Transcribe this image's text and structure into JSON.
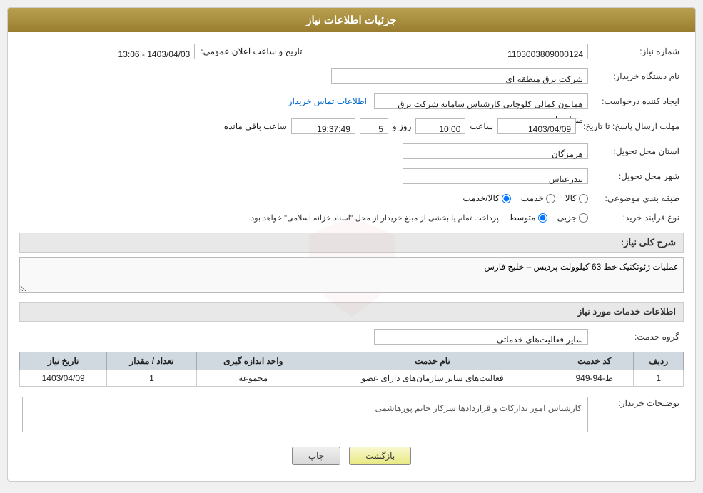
{
  "page": {
    "title": "جزئیات اطلاعات نیاز"
  },
  "header": {
    "title": "جزئیات اطلاعات نیاز"
  },
  "fields": {
    "need_number_label": "شماره نیاز:",
    "need_number_value": "1103003809000124",
    "buyer_org_label": "نام دستگاه خریدار:",
    "buyer_org_value": "شرکت برق منطقه ای",
    "creator_label": "ایجاد کننده درخواست:",
    "creator_value": "همایون کمالی کلوچانی کارشناس سامانه شرکت برق منطقه ای",
    "contact_link": "اطلاعات تماس خریدار",
    "announce_date_label": "تاریخ و ساعت اعلان عمومی:",
    "announce_date_value": "1403/04/03 - 13:06",
    "reply_deadline_label": "مهلت ارسال پاسخ: تا تاریخ:",
    "reply_date": "1403/04/09",
    "reply_time_label": "ساعت",
    "reply_time": "10:00",
    "reply_days_label": "روز و",
    "reply_days": "5",
    "reply_remaining_label": "ساعت باقی مانده",
    "reply_remaining": "19:37:49",
    "province_label": "استان محل تحویل:",
    "province_value": "هرمزگان",
    "city_label": "شهر محل تحویل:",
    "city_value": "بندرعباس",
    "category_label": "طبقه بندی موضوعی:",
    "category_goods": "کالا",
    "category_service": "خدمت",
    "category_goods_service": "کالا/خدمت",
    "purchase_type_label": "نوع فرآیند خرید:",
    "purchase_type_partial": "جزیی",
    "purchase_type_medium": "متوسط",
    "purchase_note": "پرداخت تمام یا بخشی از مبلغ خریدار از محل \"اسناد خزانه اسلامی\" خواهد بود.",
    "need_desc_label": "شرح کلی نیاز:",
    "need_desc_value": "عملیات ژئوتکنیک خط 63 کیلوولت پردیس – خلیج فارس",
    "services_section_label": "اطلاعات خدمات مورد نیاز",
    "service_group_label": "گروه خدمت:",
    "service_group_value": "سایر فعالیت‌های خدماتی",
    "table": {
      "headers": [
        "ردیف",
        "کد خدمت",
        "نام خدمت",
        "واحد اندازه گیری",
        "تعداد / مقدار",
        "تاریخ نیاز"
      ],
      "rows": [
        {
          "row": "1",
          "code": "ط-94-949",
          "name": "فعالیت‌های سایر سازمان‌های دارای عضو",
          "unit": "مجموعه",
          "count": "1",
          "date": "1403/04/09"
        }
      ]
    },
    "buyer_notes_label": "توضیحات خریدار:",
    "buyer_notes_value": "کارشناس امور تدارکات و قراردادها سرکار خانم پورهاشمی"
  },
  "buttons": {
    "print": "چاپ",
    "back": "بازگشت"
  }
}
